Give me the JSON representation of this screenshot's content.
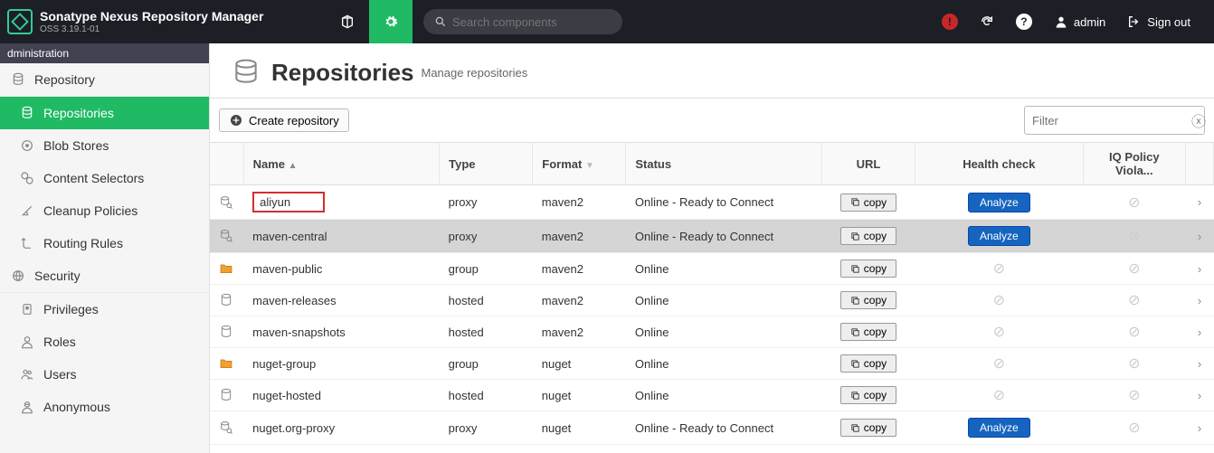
{
  "header": {
    "product": "Sonatype Nexus Repository Manager",
    "version": "OSS 3.19.1-01",
    "search_placeholder": "Search components",
    "user": "admin",
    "signout": "Sign out"
  },
  "sidebar": {
    "title": "dministration",
    "groups": [
      {
        "label": "Repository",
        "icon": "db",
        "items": [
          {
            "label": "Repositories",
            "icon": "db",
            "active": true
          },
          {
            "label": "Blob Stores",
            "icon": "disk"
          },
          {
            "label": "Content Selectors",
            "icon": "tags"
          },
          {
            "label": "Cleanup Policies",
            "icon": "broom"
          },
          {
            "label": "Routing Rules",
            "icon": "route"
          }
        ]
      },
      {
        "label": "Security",
        "icon": "globe",
        "items": [
          {
            "label": "Privileges",
            "icon": "badge"
          },
          {
            "label": "Roles",
            "icon": "user"
          },
          {
            "label": "Users",
            "icon": "users"
          },
          {
            "label": "Anonymous",
            "icon": "anon"
          }
        ]
      }
    ]
  },
  "page": {
    "title": "Repositories",
    "subtitle": "Manage repositories",
    "create": "Create repository",
    "filter_placeholder": "Filter"
  },
  "columns": [
    "Name",
    "Type",
    "Format",
    "Status",
    "URL",
    "Health check",
    "IQ Policy Viola..."
  ],
  "copy_label": "copy",
  "analyze_label": "Analyze",
  "rows": [
    {
      "name": "aliyun",
      "type": "proxy",
      "format": "maven2",
      "status": "Online - Ready to Connect",
      "analyze": true,
      "hl": true,
      "icon": "proxy"
    },
    {
      "name": "maven-central",
      "type": "proxy",
      "format": "maven2",
      "status": "Online - Ready to Connect",
      "analyze": true,
      "sel": true,
      "icon": "proxy"
    },
    {
      "name": "maven-public",
      "type": "group",
      "format": "maven2",
      "status": "Online",
      "analyze": false,
      "icon": "group"
    },
    {
      "name": "maven-releases",
      "type": "hosted",
      "format": "maven2",
      "status": "Online",
      "analyze": false,
      "icon": "hosted"
    },
    {
      "name": "maven-snapshots",
      "type": "hosted",
      "format": "maven2",
      "status": "Online",
      "analyze": false,
      "icon": "hosted"
    },
    {
      "name": "nuget-group",
      "type": "group",
      "format": "nuget",
      "status": "Online",
      "analyze": false,
      "icon": "group"
    },
    {
      "name": "nuget-hosted",
      "type": "hosted",
      "format": "nuget",
      "status": "Online",
      "analyze": false,
      "icon": "hosted"
    },
    {
      "name": "nuget.org-proxy",
      "type": "proxy",
      "format": "nuget",
      "status": "Online - Ready to Connect",
      "analyze": true,
      "icon": "proxy"
    }
  ]
}
